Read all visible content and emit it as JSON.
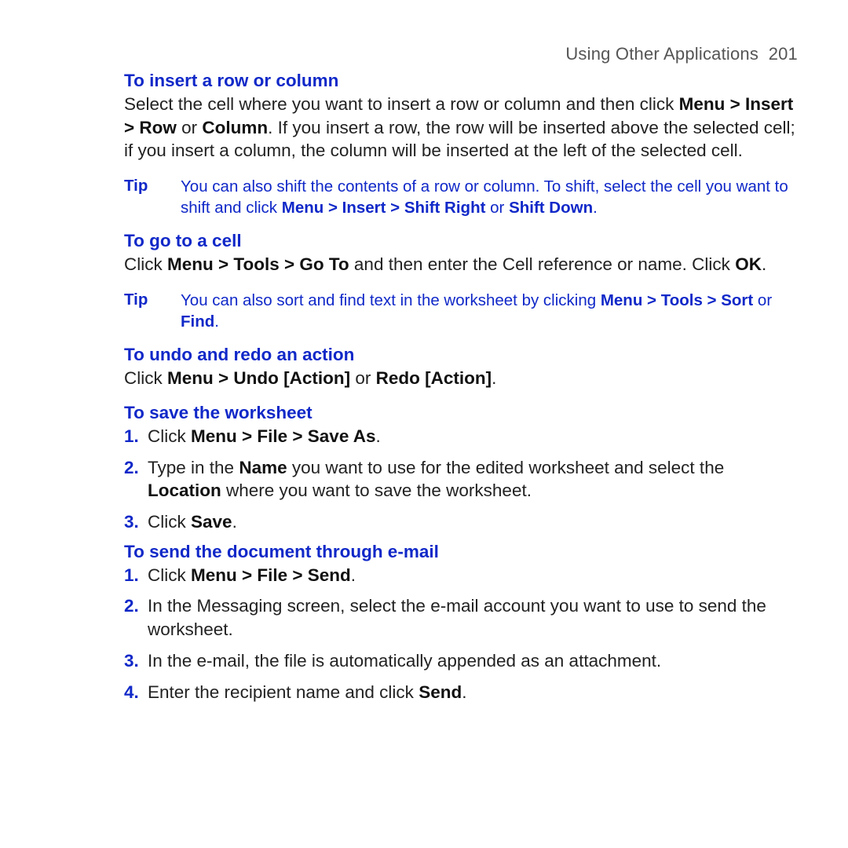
{
  "header": {
    "title": "Using Other Applications",
    "page_number": "201"
  },
  "sections": {
    "insert": {
      "heading": "To insert a row or column",
      "p1a": "Select the cell where you want to insert a row or column and then click ",
      "p1b": "Menu > Insert > Row",
      "p1c": " or ",
      "p1d": "Column",
      "p1e": ". If you insert a row, the row will be inserted above the selected cell; if you insert a column, the column will be inserted at the left of the selected cell.",
      "tip": {
        "label": "Tip",
        "t1": "You can also shift the contents of a row or column. To shift, select the cell you want to shift and click ",
        "t2": "Menu > Insert > Shift Right",
        "t3": " or ",
        "t4": "Shift Down",
        "t5": "."
      }
    },
    "goto": {
      "heading": "To go to a cell",
      "p1a": "Click ",
      "p1b": "Menu > Tools > Go To",
      "p1c": " and then enter the Cell reference or name. Click ",
      "p1d": "OK",
      "p1e": ".",
      "tip": {
        "label": "Tip",
        "t1": "You can also sort and find text in the worksheet by clicking ",
        "t2": "Menu > Tools > Sort",
        "t3": " or ",
        "t4": "Find",
        "t5": "."
      }
    },
    "undo": {
      "heading": "To undo and redo an action",
      "p1a": "Click ",
      "p1b": "Menu > Undo [Action]",
      "p1c": " or ",
      "p1d": "Redo [Action]",
      "p1e": "."
    },
    "save": {
      "heading": "To save the worksheet",
      "items": [
        {
          "num": "1.",
          "a": "Click ",
          "b": "Menu > File > Save As",
          "c": "."
        },
        {
          "num": "2.",
          "a": "Type in the ",
          "b": "Name",
          "c": " you want to use for the edited worksheet and select the ",
          "d": "Location",
          "e": " where you want to save the worksheet."
        },
        {
          "num": "3.",
          "a": "Click ",
          "b": "Save",
          "c": "."
        }
      ]
    },
    "send": {
      "heading": "To send the document through e-mail",
      "items": [
        {
          "num": "1.",
          "a": "Click ",
          "b": "Menu > File > Send",
          "c": "."
        },
        {
          "num": "2.",
          "a": "In the Messaging screen, select the e-mail account you want to use to send the worksheet."
        },
        {
          "num": "3.",
          "a": "In the e-mail, the file is automatically appended as an attachment."
        },
        {
          "num": "4.",
          "a": "Enter the recipient name and click ",
          "b": "Send",
          "c": "."
        }
      ]
    }
  }
}
